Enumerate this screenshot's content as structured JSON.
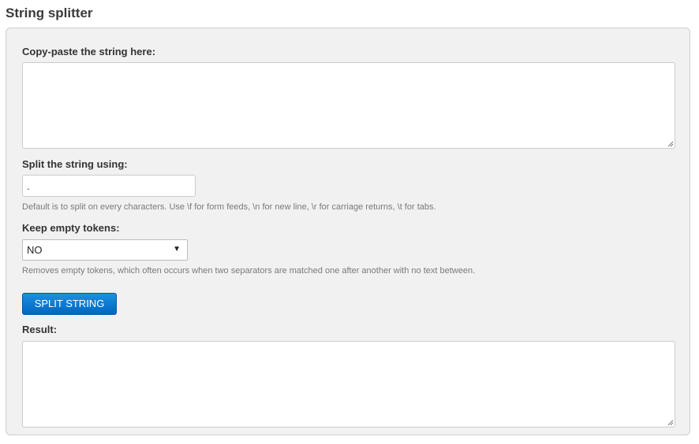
{
  "page": {
    "title": "String splitter"
  },
  "input_section": {
    "label": "Copy-paste the string here:",
    "value": ""
  },
  "separator": {
    "label": "Split the string using:",
    "value": ".",
    "hint": "Default is to split on every characters. Use \\f for form feeds, \\n for new line, \\r for carriage returns, \\t for tabs."
  },
  "empty_tokens": {
    "label": "Keep empty tokens:",
    "selected": "NO",
    "hint": "Removes empty tokens, which often occurs when two separators are matched one after another with no text between."
  },
  "actions": {
    "split_label": "SPLIT STRING"
  },
  "result": {
    "label": "Result:",
    "value": ""
  },
  "icons": {
    "dropdown": "triangle-down-icon",
    "resize": "resize-grip-icon"
  },
  "colors": {
    "accent": "#0a78d2",
    "panel_bg": "#f1f1f1"
  }
}
